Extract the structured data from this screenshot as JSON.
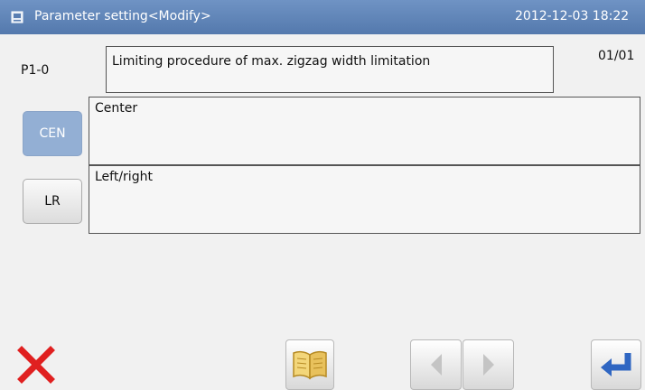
{
  "titlebar": {
    "icon": "app-window-icon",
    "title": "Parameter setting<Modify>",
    "datetime": "2012-12-03 18:22"
  },
  "parameter": {
    "code": "P1-0",
    "name": "Limiting procedure of max. zigzag width limitation",
    "page": "01/01"
  },
  "options": [
    {
      "label": "CEN",
      "description": "Center",
      "selected": true
    },
    {
      "label": "LR",
      "description": "Left/right",
      "selected": false
    }
  ],
  "toolbar": {
    "cancel_icon": "close-x-icon",
    "manual_icon": "open-book-icon",
    "prev_icon": "arrow-left-icon",
    "next_icon": "arrow-right-icon",
    "enter_icon": "enter-return-icon"
  },
  "colors": {
    "titlebar": "#5f84b9",
    "selected_option": "#93afd4",
    "cancel_red": "#e02020",
    "enter_blue": "#2f66c2",
    "book_gold": "#e8c15c"
  }
}
